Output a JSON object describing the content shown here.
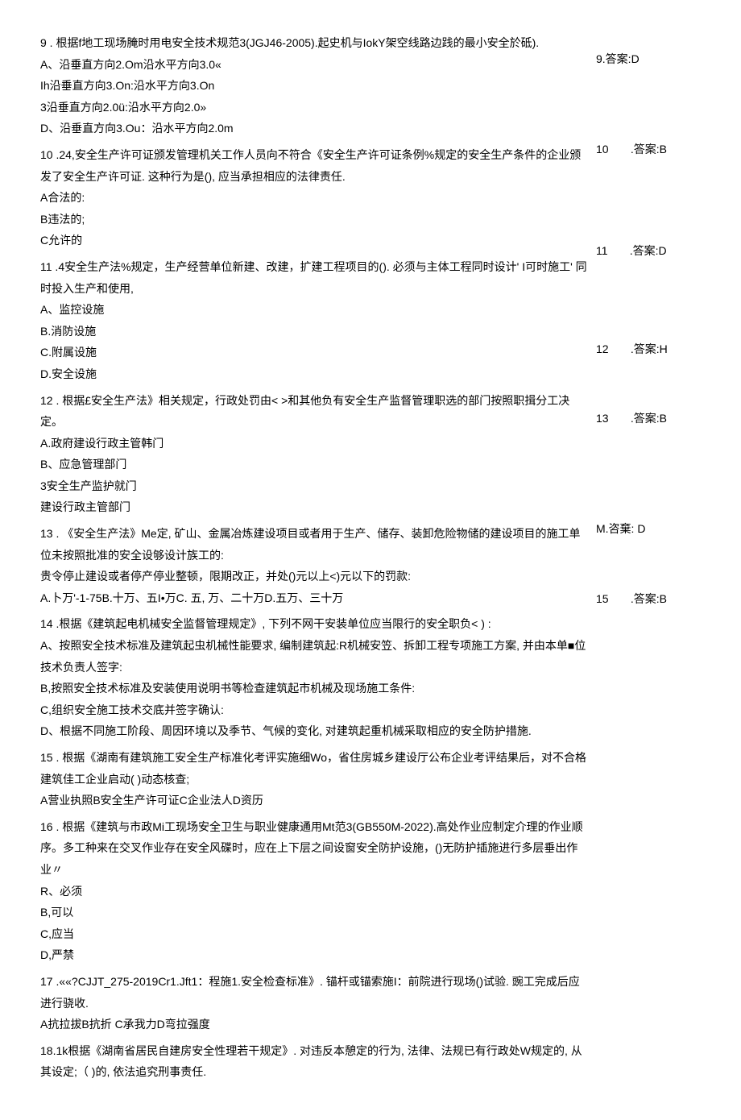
{
  "q9": {
    "text": "9 . 根据f地工现场腌时用电安全技术规范3(JGJ46-2005).起史机与IokY架空线路边践的最小安全於砥).",
    "optA": "A、沿垂直方向2.Om沿水平方向3.0«",
    "optAline2": "Ih沿垂直方向3.On:沿水平方向3.On",
    "optAline3": "3沿垂直方向2.0ü:沿水平方向2.0»",
    "optD": "D、沿垂直方向3.Ou：沿水平方向2.0m"
  },
  "q10": {
    "text": "10 .24,安全生产许可证颁发管理机关工作人员向不符合《安全生产许可证条例%规定的安全生产条件的企业颁发了安全生产许可证. 这种行为是(), 应当承担相应的法律责任.",
    "optA": "A合法的:",
    "optB": "B违法的;",
    "optC": "C允许的"
  },
  "q11": {
    "text": "11 .4安全生产法%规定，生产经营单位新建、改建，扩建工程项目的(). 必须与主体工程同时设计' I可时施工' 同时投入生产和使用,",
    "optA": "A、监控设施",
    "optB": "B.消防设施",
    "optC": "C.附属设施",
    "optD": "D.安全设施"
  },
  "q12": {
    "text": "12 . 根据£安全生产法》相关规定，行政处罚由<          >和其他负有安全生产监督管理职选的部门按照职揖分工决定。",
    "optA": "A.政府建设行政主管韩门",
    "optB": "B、应急管理部门",
    "optC": "3安全生产监护就门",
    "optD": "建设行政主管部门"
  },
  "q13": {
    "text": "13 . 《安全生产法》Me定, 矿山、金属冶炼建设项目或者用于生产、储存、装卸危险物储的建设项目的施工单位未按照批准的安全设够设计族工的:",
    "text2": "贵令停止建设或者停产停业整顿，限期改正，并处()元以上<)元以下的罚款:",
    "opts": "A.卜万'-1-75B.十万、五I•万C. 五, 万、二十万D.五万、三十万"
  },
  "q14": {
    "text": "14 .根据《建筑起电机械安全监督管理规定》, 下列不网干安装单位应当限行的安全职负<                            ) :",
    "optA": "A、按照安全技术标准及建筑起虫机械性能要求, 编制建筑起:R机械安笠、拆卸工程专项施工方案, 并由本单■位技术负责人签字:",
    "optB": "B,按照安全技术标准及安装使用说明书等检查建筑起市机械及现场施工条件:",
    "optC": "C,组织安全施工技术交底并签字确认:",
    "optD": "D、根据不同施工阶段、周因环境以及季节、气候的变化, 对建筑起重机械采取相应的安全防护措施."
  },
  "q15": {
    "text": "15 . 根据《湖南有建筑施工安全生产标准化考评实施细Wo，省住房城乡建设厅公布企业考评结果后，对不合格建筑佳工企业启动(                          )动态核查;",
    "opts": "A营业执照B安全生产许可证C企业法人D资历"
  },
  "q16": {
    "text": "16 . 根据《建筑与市政Mi工现场安全卫生与职业健康通用Mt范3(GB550M-2022).高处作业应制定介理的作业顺序。多工种来在交叉作业存在安全风碟时，应在上下层之间设窗安全防护设施，()无防护插施进行多层垂出作业〃",
    "optA": "R、必须",
    "optB": "B,可以",
    "optC": "C,应当",
    "optD": "D,严禁"
  },
  "q17": {
    "text": "17 .««?CJJT_275-2019Cr1.Jft1：程施1.安全检查标准》. 锚杆或锚索施I：前院进行现场()试验. 豌工完成后应进行骁收.",
    "opts": "A抗拉拔B抗折                                        C承我力D弯拉强度"
  },
  "q18": {
    "text": "18.1k根据《湖南省居民自建房安全性理若干规定》. 对违反本憩定的行为, 法律、法规已有行政处W规定的, 从其设定;（                                         )的, 依法追究刑事责任."
  },
  "ans": {
    "a9": "9.答案:D",
    "a10a": "10",
    "a10b": ".答案:B",
    "a11a": "11",
    "a11b": ".答案:D",
    "a12a": "12",
    "a12b": ".答案:H",
    "a13a": "13",
    "a13b": ".答案:B",
    "a14": "M.咨棄: D",
    "a15a": "15",
    "a15b": ".答案:B"
  }
}
